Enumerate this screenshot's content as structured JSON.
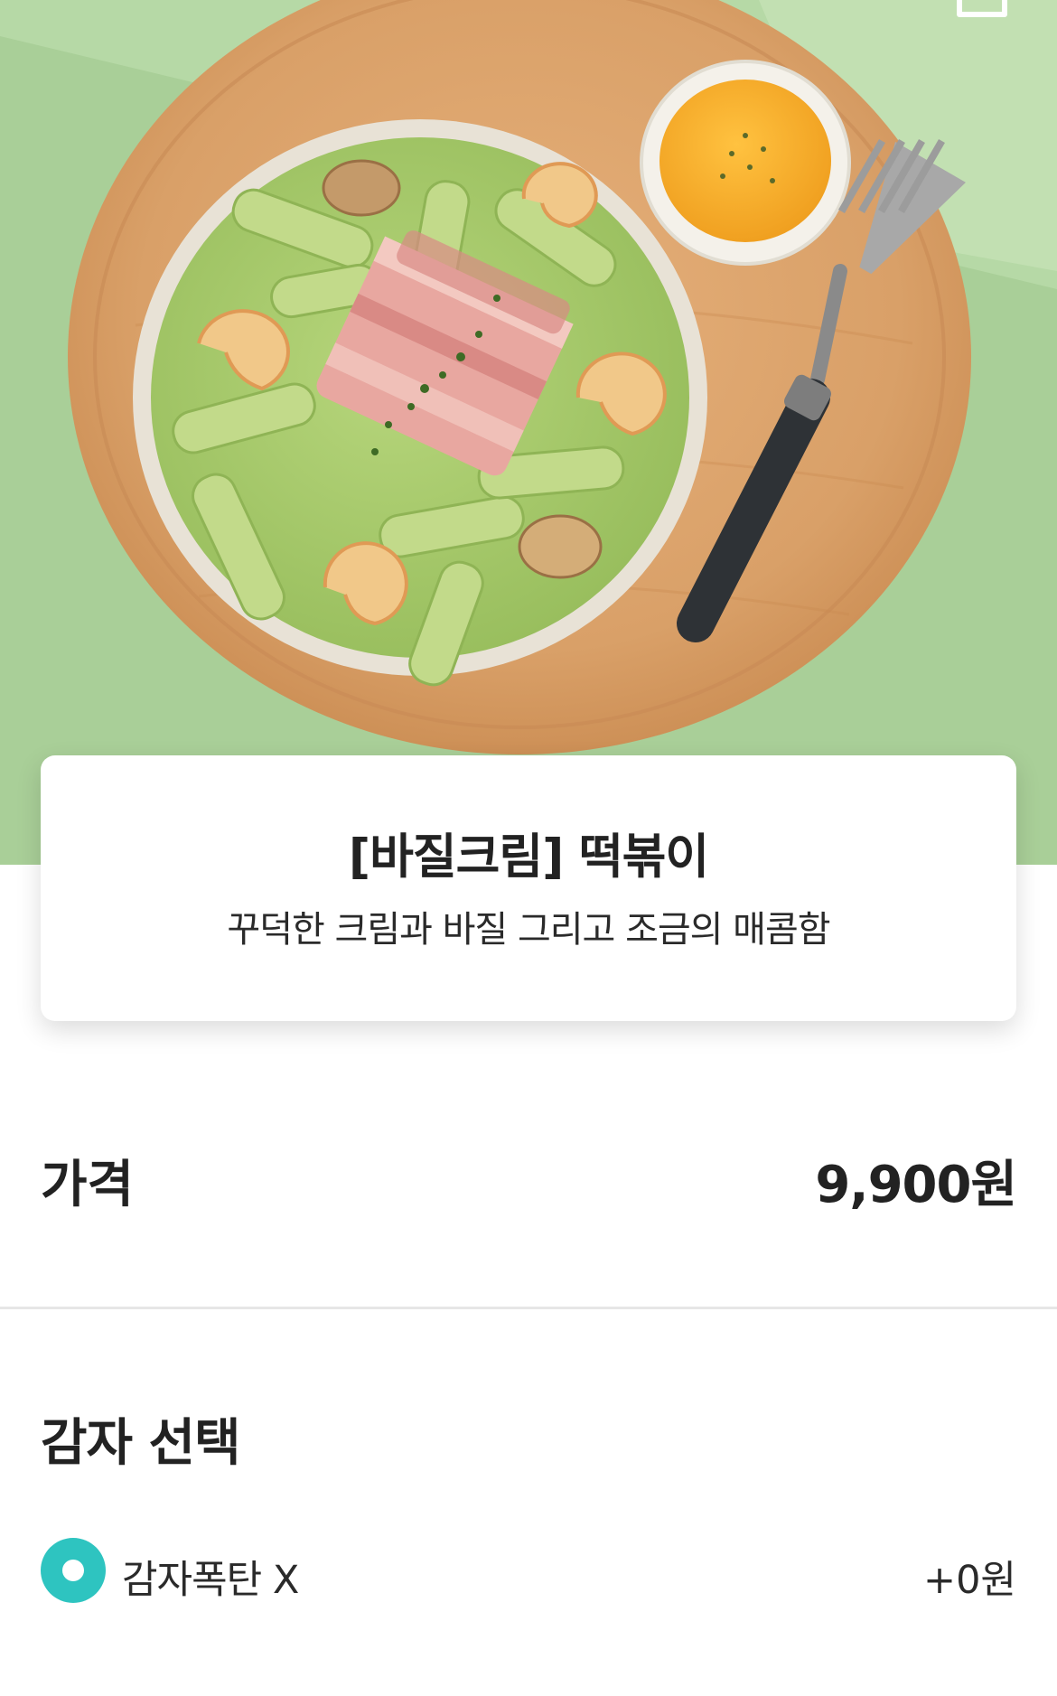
{
  "menu_item": {
    "name": "[바질크림] 떡볶이",
    "description": "꾸덕한 크림과 바질 그리고 조금의 매콤함"
  },
  "price": {
    "label": "가격",
    "value": "9,900원"
  },
  "options": {
    "section_title": "감자 선택",
    "items": [
      {
        "label": "감자폭탄 X",
        "price": "+0원",
        "selected": true
      }
    ]
  },
  "icons": {
    "back": "chevron-left-icon",
    "cart": "cart-icon",
    "radio": "radio-selected-icon"
  },
  "colors": {
    "accent": "#2ec4c0",
    "hero_background": "#a9cf98",
    "sauce": "#a5c86a"
  }
}
